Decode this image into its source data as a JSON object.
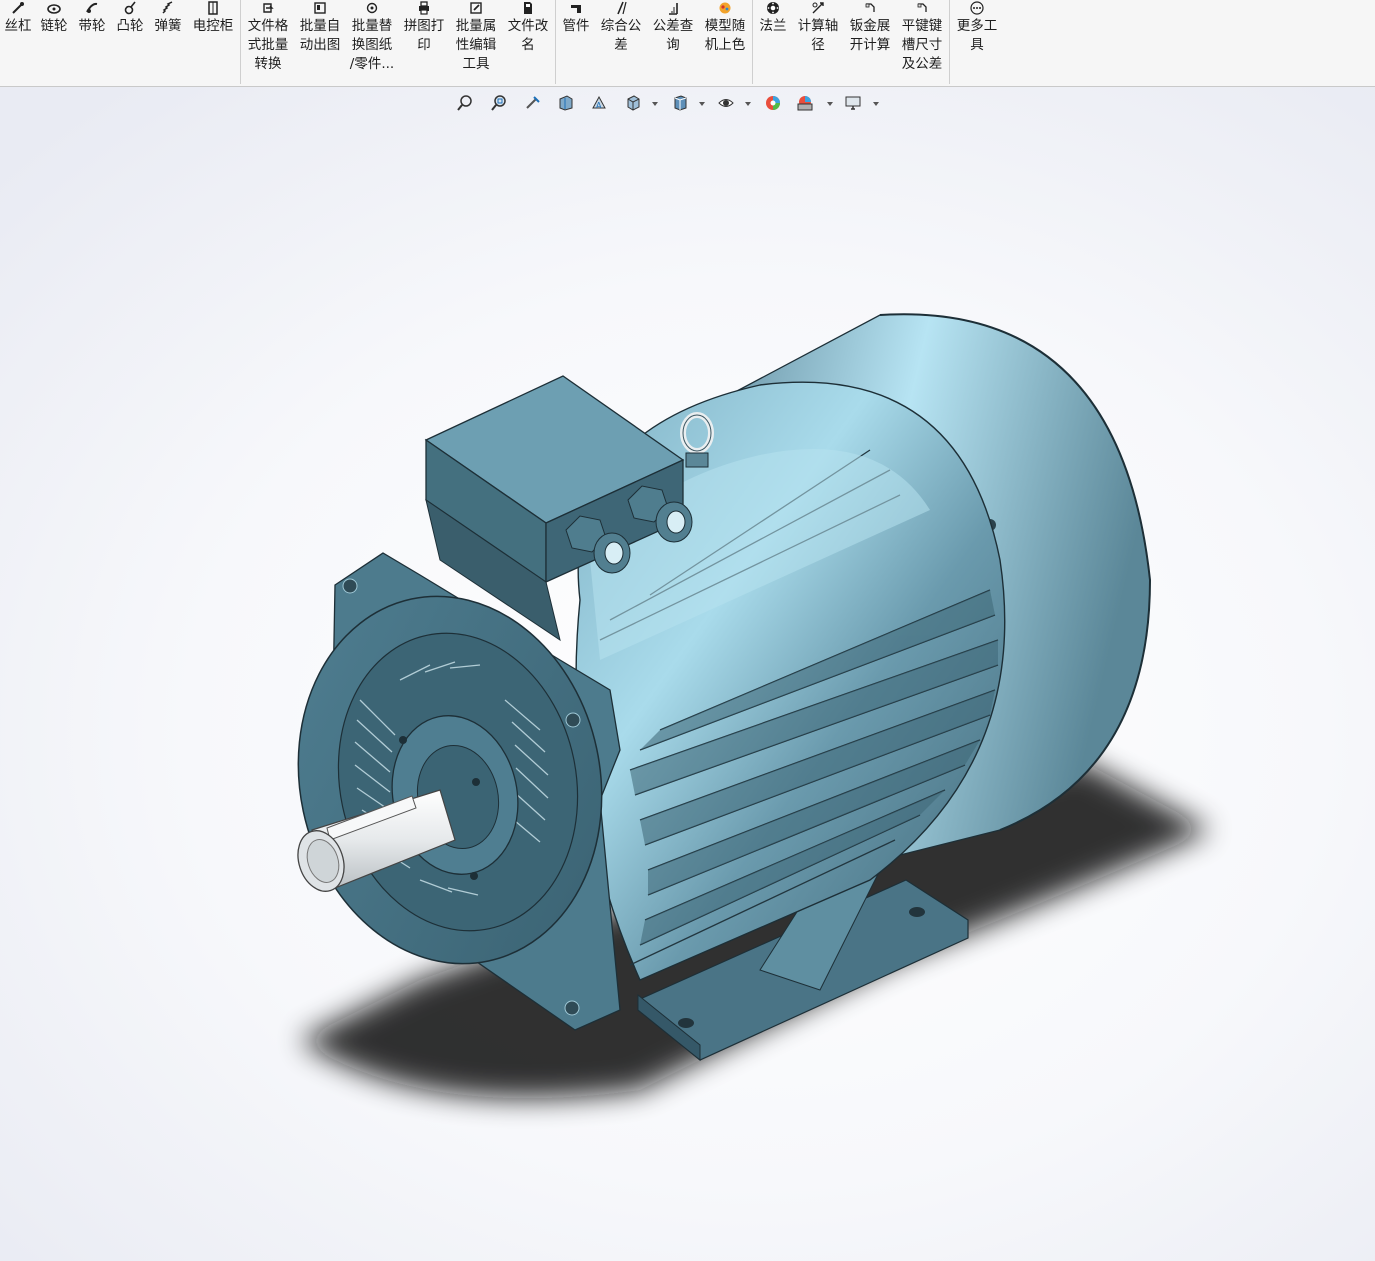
{
  "ribbon": {
    "groups": [
      {
        "items": [
          {
            "id": "screw",
            "label": "丝杠",
            "icon": "screw-icon"
          },
          {
            "id": "sprocket",
            "label": "链轮",
            "icon": "sprocket-icon"
          },
          {
            "id": "pulley",
            "label": "带轮",
            "icon": "pulley-icon"
          },
          {
            "id": "cam",
            "label": "凸轮",
            "icon": "cam-icon"
          },
          {
            "id": "spring",
            "label": "弹簧",
            "icon": "spring-icon"
          },
          {
            "id": "cabinet",
            "label": "电控柜",
            "icon": "cabinet-icon"
          }
        ]
      },
      {
        "items": [
          {
            "id": "batch-convert",
            "label": "文件格\n式批量\n转换",
            "icon": "convert-icon"
          },
          {
            "id": "batch-drawing",
            "label": "批量自\n动出图",
            "icon": "drawing-icon"
          },
          {
            "id": "batch-replace",
            "label": "批量替\n换图纸\n/零件...",
            "icon": "replace-icon"
          },
          {
            "id": "tile-print",
            "label": "拼图打\n印",
            "icon": "print-icon"
          },
          {
            "id": "batch-props",
            "label": "批量属\n性编辑\n工具",
            "icon": "edit-props-icon"
          },
          {
            "id": "file-rename",
            "label": "文件改\n名",
            "icon": "rename-icon"
          }
        ]
      },
      {
        "items": [
          {
            "id": "pipe",
            "label": "管件",
            "icon": "pipe-icon"
          },
          {
            "id": "tolerance",
            "label": "综合公\n差",
            "icon": "tolerance-icon"
          },
          {
            "id": "tol-lookup",
            "label": "公差查\n询",
            "icon": "lookup-icon"
          },
          {
            "id": "random-color",
            "label": "模型随\n机上色",
            "icon": "color-icon"
          }
        ]
      },
      {
        "items": [
          {
            "id": "flange",
            "label": "法兰",
            "icon": "flange-icon"
          },
          {
            "id": "shaft-calc",
            "label": "计算轴\n径",
            "icon": "shaft-icon"
          },
          {
            "id": "sheet-metal",
            "label": "钣金展\n开计算",
            "icon": "sheet-metal-icon"
          },
          {
            "id": "keyway",
            "label": "平键键\n槽尺寸\n及公差",
            "icon": "keyway-icon"
          }
        ]
      },
      {
        "items": [
          {
            "id": "more-tools",
            "label": "更多工\n具",
            "icon": "more-icon"
          }
        ]
      }
    ]
  },
  "hud": {
    "buttons": [
      {
        "id": "zoom-fit",
        "icon": "zoom-to-fit-icon"
      },
      {
        "id": "zoom-area",
        "icon": "zoom-to-area-icon"
      },
      {
        "id": "previous-view",
        "icon": "previous-view-icon"
      },
      {
        "id": "section-view",
        "icon": "section-view-icon"
      },
      {
        "id": "dynamic-annotation",
        "icon": "dynamic-annotation-icon"
      },
      {
        "id": "view-orientation",
        "icon": "view-orientation-icon",
        "dropdown": true
      },
      {
        "id": "display-style",
        "icon": "display-style-icon",
        "dropdown": true
      },
      {
        "id": "hide-show",
        "icon": "hide-show-icon",
        "dropdown": true
      },
      {
        "id": "edit-appearance",
        "icon": "edit-appearance-icon"
      },
      {
        "id": "apply-scene",
        "icon": "apply-scene-icon",
        "dropdown": true
      },
      {
        "id": "view-settings",
        "icon": "view-settings-icon",
        "dropdown": true
      }
    ]
  },
  "model": {
    "name": "",
    "body_color": "#5a8799",
    "highlight_color": "#bfe6f2",
    "shadow_color": "#2f4d5a",
    "shaft_color": "#e4e6e8"
  },
  "colors": {
    "ribbon_bg": "#f6f6f6",
    "viewport_bg": "#ffffff",
    "accent": "#1c6fb8"
  }
}
